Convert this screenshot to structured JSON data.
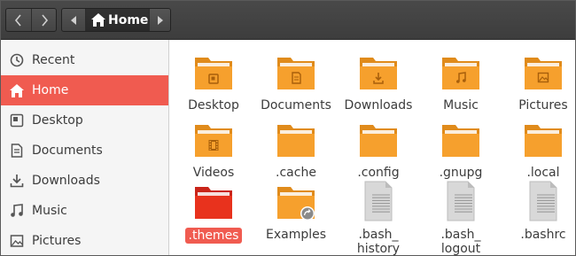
{
  "toolbar": {
    "location_label": "Home",
    "back_icon": "chevron-left-icon",
    "forward_icon": "chevron-right-icon"
  },
  "sidebar": {
    "items": [
      {
        "label": "Recent",
        "icon": "clock-icon",
        "active": false
      },
      {
        "label": "Home",
        "icon": "home-icon",
        "active": true
      },
      {
        "label": "Desktop",
        "icon": "desktop-icon",
        "active": false
      },
      {
        "label": "Documents",
        "icon": "document-icon",
        "active": false
      },
      {
        "label": "Downloads",
        "icon": "download-icon",
        "active": false
      },
      {
        "label": "Music",
        "icon": "music-icon",
        "active": false
      },
      {
        "label": "Pictures",
        "icon": "picture-icon",
        "active": false
      }
    ]
  },
  "files": [
    {
      "name": "Desktop",
      "type": "folder",
      "emblem": "desktop"
    },
    {
      "name": "Documents",
      "type": "folder",
      "emblem": "document"
    },
    {
      "name": "Downloads",
      "type": "folder",
      "emblem": "download"
    },
    {
      "name": "Music",
      "type": "folder",
      "emblem": "music"
    },
    {
      "name": "Pictures",
      "type": "folder",
      "emblem": "picture"
    },
    {
      "name": "Videos",
      "type": "folder",
      "emblem": "video"
    },
    {
      "name": ".cache",
      "type": "folder",
      "emblem": ""
    },
    {
      "name": ".config",
      "type": "folder",
      "emblem": ""
    },
    {
      "name": ".gnupg",
      "type": "folder",
      "emblem": ""
    },
    {
      "name": ".local",
      "type": "folder",
      "emblem": ""
    },
    {
      "name": ".themes",
      "type": "folder-red",
      "emblem": "",
      "selected": true
    },
    {
      "name": "Examples",
      "type": "folder",
      "emblem": "link"
    },
    {
      "name_lines": [
        ".bash_",
        "history"
      ],
      "type": "text-file"
    },
    {
      "name_lines": [
        ".bash_",
        "logout"
      ],
      "type": "text-file"
    },
    {
      "name": ".bashrc",
      "type": "text-file"
    }
  ],
  "colors": {
    "accent": "#f05b50",
    "folder": "#f6a02d",
    "folder_dark": "#e08b1b",
    "folder_red": "#e8321d"
  }
}
